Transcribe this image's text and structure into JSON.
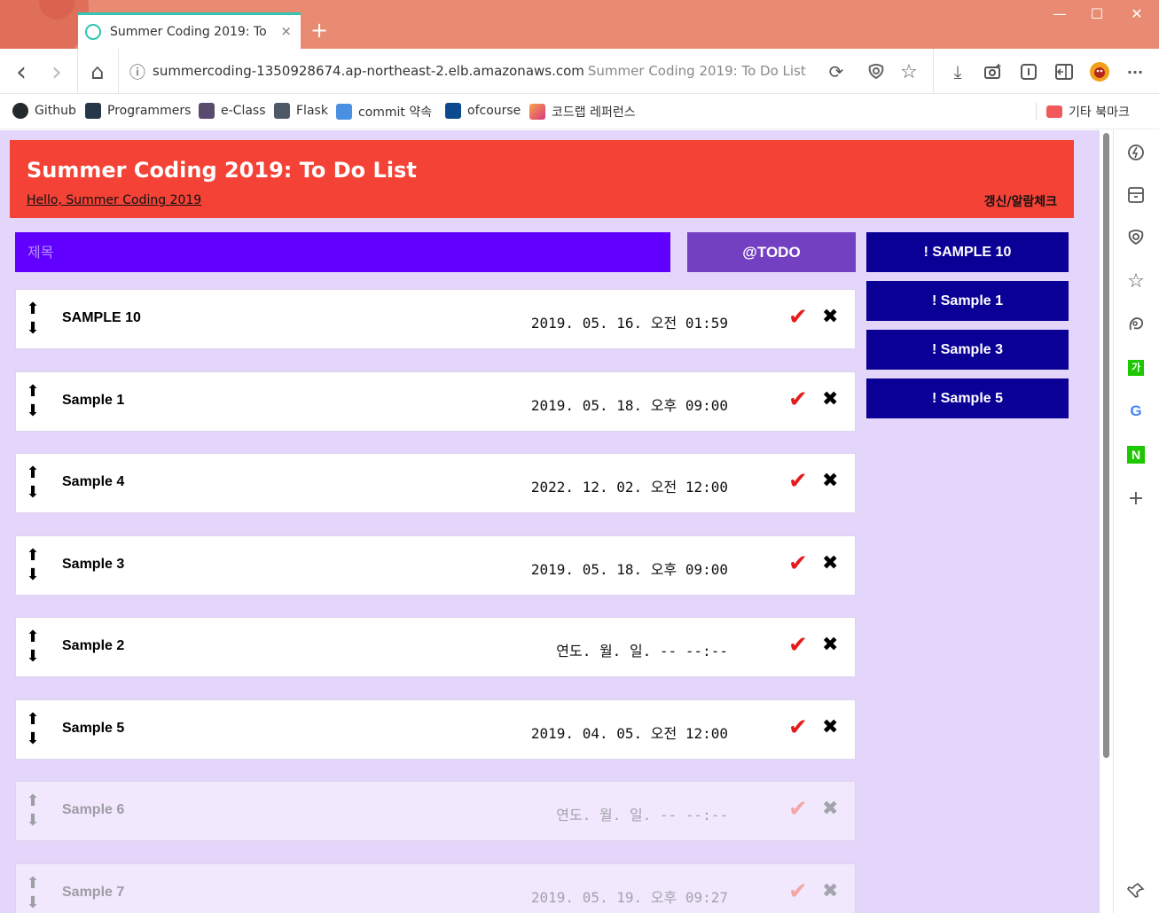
{
  "browser": {
    "tab_title": "Summer Coding 2019: To Do List",
    "tab_close": "×",
    "new_tab": "+",
    "url": "summercoding-1350928674.ap-northeast-2.elb.amazonaws.com",
    "page_title": "Summer Coding 2019: To Do List",
    "window_controls": {
      "minimize": "—",
      "maximize": "☐",
      "close": "✕"
    },
    "nav": {
      "back": "‹",
      "forward": "›",
      "home": "⌂",
      "info": "ⓘ",
      "reload": "⟳",
      "download": "⤓",
      "more": "···"
    },
    "bookmarks": [
      {
        "label": "Github",
        "icon": "github-icon",
        "color": "#24292e"
      },
      {
        "label": "Programmers",
        "icon": "programmers-icon",
        "color": "#263747"
      },
      {
        "label": "e-Class",
        "icon": "eclass-icon",
        "color": "#5a4a6e"
      },
      {
        "label": "Flask",
        "icon": "flask-icon",
        "color": "#4d5a66"
      },
      {
        "label": "commit 약속",
        "icon": "m-icon",
        "color": "#4a90e2"
      },
      {
        "label": "ofcourse",
        "icon": "code-icon",
        "color": "#0c4a8f"
      },
      {
        "label": "코드랩 레퍼런스",
        "icon": "codelab-icon",
        "color": "#e8506a"
      },
      {
        "label": "기타 북마크",
        "icon": "folder-icon",
        "color": "#f05a5a"
      }
    ]
  },
  "header": {
    "title": "Summer Coding 2019: To Do List",
    "greeting": "Hello, Summer Coding 2019",
    "refresh_label": "갱신/알람체크"
  },
  "form": {
    "title_placeholder": "제목",
    "todo_button": "@TODO"
  },
  "deadline_alerts": [
    "! SAMPLE 10",
    "! Sample 1",
    "! Sample 3",
    "! Sample 5"
  ],
  "todos": [
    {
      "title": "SAMPLE 10",
      "date": "2019. 05. 16. 오전 01:59",
      "done": false
    },
    {
      "title": "Sample 1",
      "date": "2019. 05. 18. 오후 09:00",
      "done": false
    },
    {
      "title": "Sample 4",
      "date": "2022. 12. 02. 오전 12:00",
      "done": false
    },
    {
      "title": "Sample 3",
      "date": "2019. 05. 18. 오후 09:00",
      "done": false
    },
    {
      "title": "Sample 2",
      "date": "연도. 월. 일. -- --:--",
      "done": false
    },
    {
      "title": "Sample 5",
      "date": "2019. 04. 05. 오전 12:00",
      "done": false
    },
    {
      "title": "Sample 6",
      "date": "연도. 월. 일. -- --:--",
      "done": true
    },
    {
      "title": "Sample 7",
      "date": "2019. 05. 19. 오후 09:27",
      "done": true
    }
  ],
  "icons": {
    "up": "⬆",
    "down": "⬇",
    "check": "✔",
    "delete": "✖"
  },
  "colors": {
    "header": "#f44236",
    "title_input": "#6200ff",
    "todo_button": "#7440c2",
    "deadline": "#0a0095",
    "page_bg": "#e4d5fb",
    "check": "#e51b1b"
  }
}
